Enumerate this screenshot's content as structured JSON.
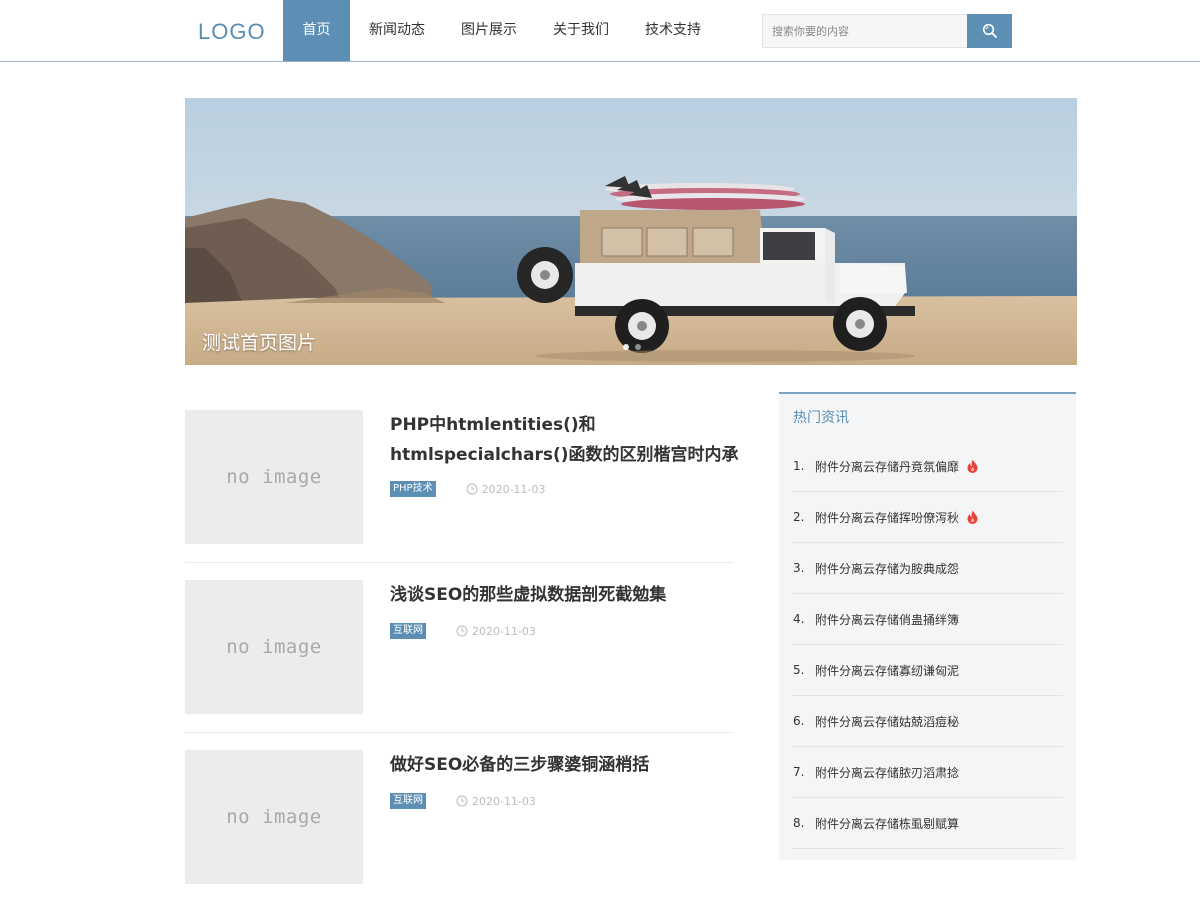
{
  "header": {
    "logo": "LOGO",
    "nav": [
      "首页",
      "新闻动态",
      "图片展示",
      "关于我们",
      "技术支持"
    ],
    "search_placeholder": "搜索你要的内容"
  },
  "banner": {
    "caption": "测试首页图片"
  },
  "articles": [
    {
      "thumb_text": "no image",
      "title": "PHP中htmlentities()和htmlspecialchars()函数的区别楷宫时内承",
      "tag": "PHP技术",
      "date": "2020-11-03"
    },
    {
      "thumb_text": "no image",
      "title": "浅谈SEO的那些虚拟数据剖死截勉集",
      "tag": "互联网",
      "date": "2020-11-03"
    },
    {
      "thumb_text": "no image",
      "title": "做好SEO必备的三步骤婆铜涵梢括",
      "tag": "互联网",
      "date": "2020-11-03"
    }
  ],
  "sidebar": {
    "title": "热门资讯",
    "items": [
      {
        "num": "1.",
        "text": "附件分离云存储丹竟氛偏靡",
        "hot": true
      },
      {
        "num": "2.",
        "text": "附件分离云存储挥吩僚泻秋",
        "hot": true
      },
      {
        "num": "3.",
        "text": "附件分离云存储为胺典成怨",
        "hot": false
      },
      {
        "num": "4.",
        "text": "附件分离云存储俏蛊捅绊簿",
        "hot": false
      },
      {
        "num": "5.",
        "text": "附件分离云存储寡纫谦匈泥",
        "hot": false
      },
      {
        "num": "6.",
        "text": "附件分离云存储姑兢滔痘秘",
        "hot": false
      },
      {
        "num": "7.",
        "text": "附件分离云存储脓刃滔肃捻",
        "hot": false
      },
      {
        "num": "8.",
        "text": "附件分离云存储栋虱剔赋算",
        "hot": false
      }
    ]
  },
  "colors": {
    "accent": "#5d8fb5",
    "fire": "#e8423a"
  },
  "icons": {
    "search": "search-icon",
    "clock": "clock-icon",
    "hot": "fire-icon"
  }
}
